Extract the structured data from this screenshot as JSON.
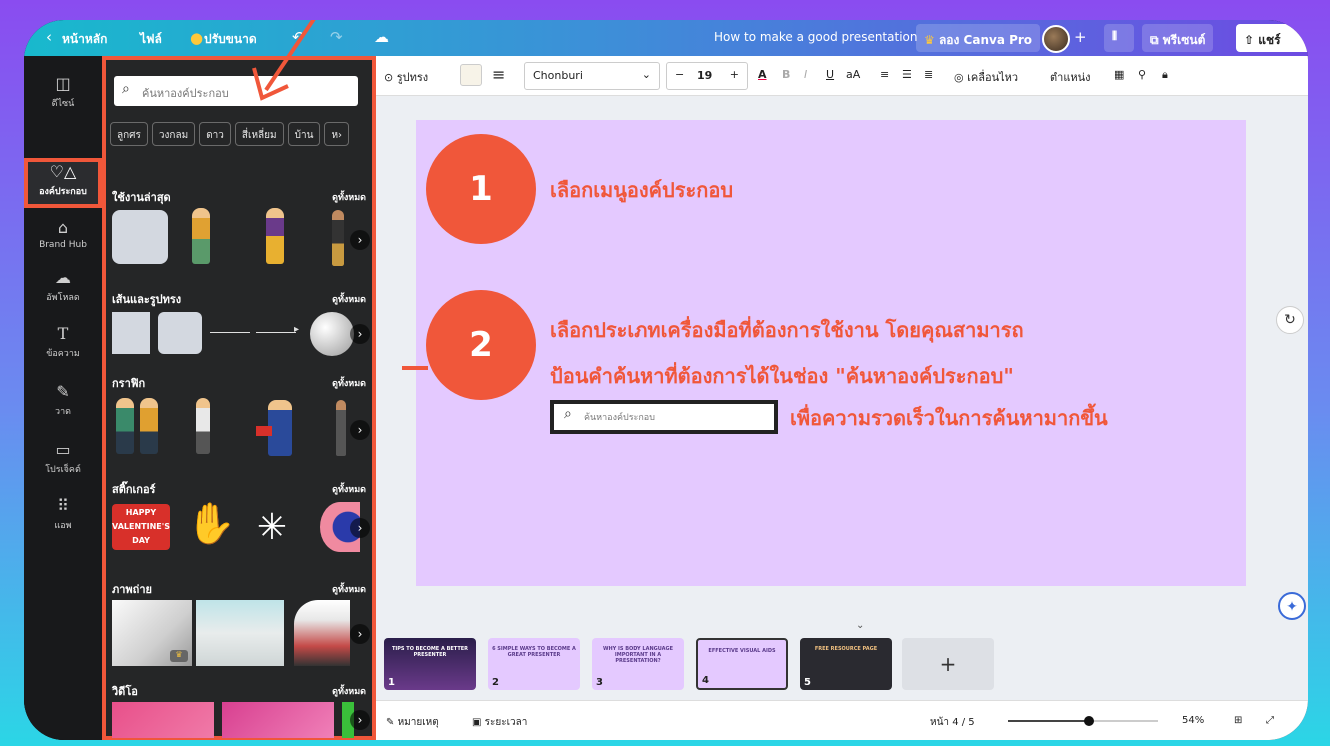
{
  "topbar": {
    "home": "หน้าหลัก",
    "file": "ไฟล์",
    "resize": "ปรับขนาด",
    "title": "How to make a good presentation",
    "try_pro": "ลอง Canva Pro",
    "present": "พรีเซนต์",
    "share": "แชร์"
  },
  "rail": {
    "design": "ดีไซน์",
    "elements": "องค์ประกอบ",
    "brand": "Brand Hub",
    "upload": "อัพโหลด",
    "text": "ข้อความ",
    "draw": "วาด",
    "projects": "โปรเจ็คต์",
    "apps": "แอพ"
  },
  "panel": {
    "search_placeholder": "ค้นหาองค์ประกอบ",
    "chips": [
      "ลูกศร",
      "วงกลม",
      "ดาว",
      "สี่เหลี่ยม",
      "บ้าน",
      "ห"
    ],
    "see_all": "ดูทั้งหมด",
    "sections": {
      "recent": "ใช้งานล่าสุด",
      "shapes": "เส้นและรูปทรง",
      "graphics": "กราฟิก",
      "stickers": "สติ๊กเกอร์",
      "photos": "ภาพถ่าย",
      "videos": "วิดีโอ"
    },
    "sticker_text": "HAPPY VALENTINE'S DAY"
  },
  "format": {
    "shape": "รูปทรง",
    "font": "Chonburi",
    "size": "19",
    "animate": "เคลื่อนไหว",
    "position": "ตำแหน่ง"
  },
  "slide": {
    "step1_num": "1",
    "step1_text": "เลือกเมนูองค์ประกอบ",
    "step2_num": "2",
    "step2_line1": "เลือกประเภทเครื่องมือที่ต้องการใช้งาน   โดยคุณสามารถ",
    "step2_line2": "ป้อนคำค้นหาที่ต้องการได้ในช่อง \"ค้นหาองค์ประกอบ\"",
    "step2_line3": "เพื่อความรวดเร็วในการค้นหามากขึ้น",
    "demo_search": "ค้นหาองค์ประกอบ"
  },
  "pages": [
    {
      "num": "1",
      "title": "TIPS TO BECOME A BETTER PRESENTER"
    },
    {
      "num": "2",
      "title": "6 SIMPLE WAYS TO BECOME A GREAT PRESENTER"
    },
    {
      "num": "3",
      "title": "WHY IS BODY LANGUAGE IMPORTANT IN A PRESENTATION?"
    },
    {
      "num": "4",
      "title": "EFFECTIVE VISUAL AIDS"
    },
    {
      "num": "5",
      "title": "FREE RESOURCE PAGE"
    }
  ],
  "bottom": {
    "notes": "หมายเหตุ",
    "timer": "ระยะเวลา",
    "page_indicator": "หน้า 4 / 5",
    "zoom": "54%",
    "zoom_fraction": 0.54
  },
  "colors": {
    "accent": "#f0573a",
    "slide_bg": "#e4c9ff"
  }
}
